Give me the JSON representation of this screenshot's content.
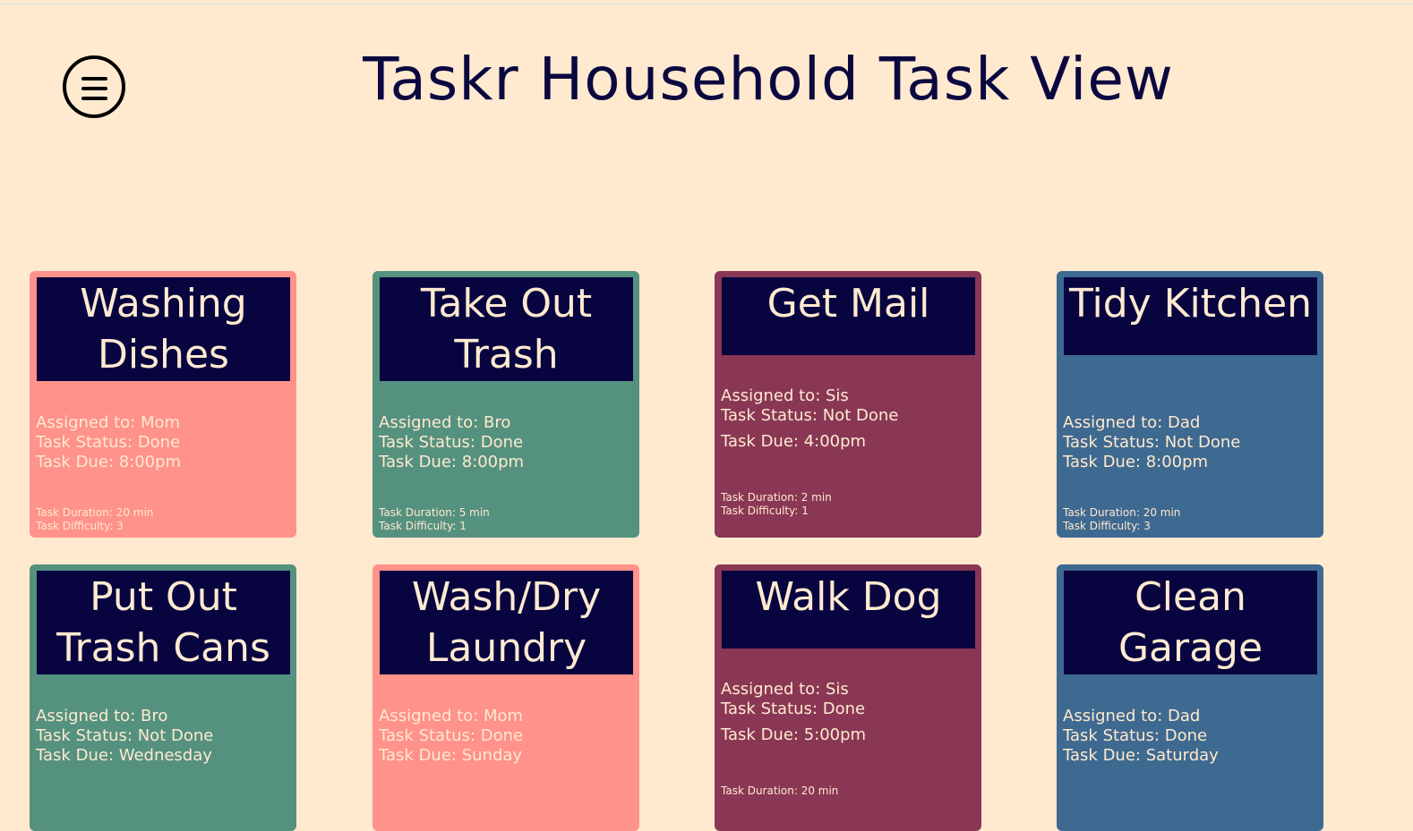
{
  "header": {
    "title": "Taskr Household Task View",
    "menu_icon": "hamburger-menu-icon"
  },
  "colors": {
    "background": "#ffead0",
    "title": "#0b0840",
    "card_header": "#070440",
    "card_text": "#ffead0",
    "salmon": "#ff928a",
    "green": "#55917f",
    "plum": "#893755",
    "blue": "#3e6990"
  },
  "tasks": [
    {
      "title": "Washing Dishes",
      "assigned": "Assigned to: Mom",
      "status": "Task Status: Done",
      "due": "Task Due: 8:00pm",
      "duration": "Task Duration: 20 min",
      "difficulty": "Task Difficulty: 3"
    },
    {
      "title": "Take Out Trash",
      "assigned": "Assigned to: Bro",
      "status": "Task Status: Done",
      "due": "Task Due: 8:00pm",
      "duration": "Task Duration: 5 min",
      "difficulty": "Task Difficulty: 1"
    },
    {
      "title": "Get Mail",
      "assigned": "Assigned to: Sis",
      "status": "Task Status: Not Done",
      "due": "Task Due: 4:00pm",
      "duration": "Task Duration: 2 min",
      "difficulty": "Task Difficulty: 1"
    },
    {
      "title": "Tidy Kitchen",
      "assigned": "Assigned to: Dad",
      "status": "Task Status: Not Done",
      "due": "Task Due: 8:00pm",
      "duration": "Task Duration: 20 min",
      "difficulty": "Task Difficulty: 3"
    },
    {
      "title": "Put Out Trash Cans",
      "assigned": "Assigned to: Bro",
      "status": "Task Status: Not Done",
      "due": "Task Due: Wednesday"
    },
    {
      "title": "Wash/Dry Laundry",
      "assigned": "Assigned to: Mom",
      "status": "Task Status: Done",
      "due": "Task Due: Sunday"
    },
    {
      "title": "Walk Dog",
      "assigned": "Assigned to: Sis",
      "status": "Task Status: Done",
      "due": "Task Due: 5:00pm",
      "duration": "Task Duration: 20 min"
    },
    {
      "title": "Clean Garage",
      "assigned": "Assigned to: Dad",
      "status": "Task Status: Done",
      "due": "Task Due: Saturday"
    }
  ]
}
